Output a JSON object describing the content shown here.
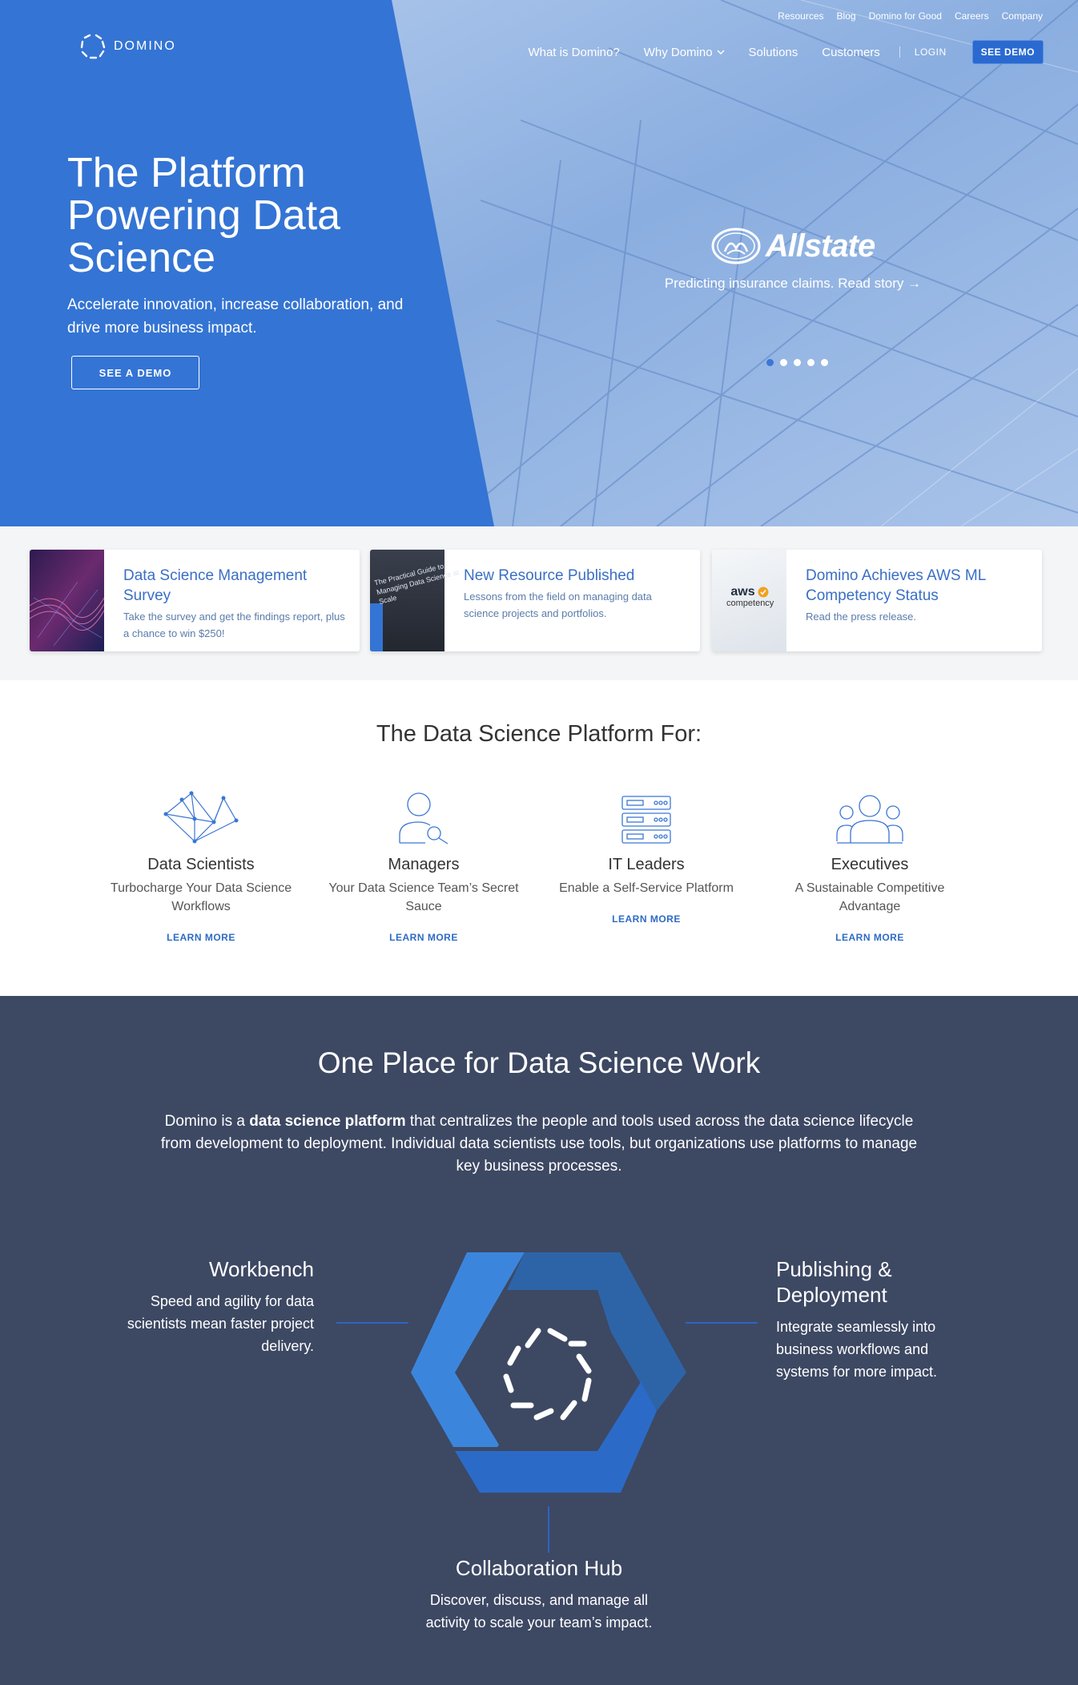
{
  "colors": {
    "hero_blue": "#3474d4",
    "accent_blue": "#2a6ad0",
    "link_blue": "#3a6fc4",
    "dark_section": "#3d4863"
  },
  "utility_nav": [
    "Resources",
    "Blog",
    "Domino for Good",
    "Careers",
    "Company"
  ],
  "logo": {
    "text": "DOMINO",
    "icon": "domino-logo-icon"
  },
  "main_nav": {
    "items": [
      "What is Domino?",
      "Why Domino",
      "Solutions",
      "Customers"
    ],
    "login": "LOGIN",
    "demo_button": "SEE DEMO"
  },
  "hero": {
    "title": "The Platform Powering Data Science",
    "subtitle": "Accelerate innovation, increase collaboration, and drive more business impact.",
    "cta": "SEE A DEMO",
    "slide": {
      "brand": "Allstate",
      "caption": "Predicting insurance claims. Read story →"
    },
    "carousel": {
      "count": 5,
      "active": 0
    }
  },
  "cards": [
    {
      "title": "Data Science Management Survey",
      "desc": "Take the survey and get the findings report, plus a chance to win $250!"
    },
    {
      "title": "New Resource Published",
      "desc": "Lessons from the field on managing data science projects and portfolios.",
      "thumb_text": "The Practical Guide to Managing Data Science at Scale"
    },
    {
      "title": "Domino Achieves AWS ML Competency Status",
      "desc": "Read the press release.",
      "thumb_text_1": "aws",
      "thumb_text_2": "competency"
    }
  ],
  "platform": {
    "heading": "The Data Science Platform For:",
    "personas": [
      {
        "title": "Data Scientists",
        "sub": "Turbocharge Your Data Science Workflows",
        "link": "LEARN MORE",
        "icon": "network-graph-icon"
      },
      {
        "title": "Managers",
        "sub": "Your Data Science Team’s Secret Sauce",
        "link": "LEARN MORE",
        "icon": "person-search-icon"
      },
      {
        "title": "IT Leaders",
        "sub": "Enable a Self-Service Platform",
        "link": "LEARN MORE",
        "icon": "server-rack-icon"
      },
      {
        "title": "Executives",
        "sub": "A Sustainable Competitive Advantage",
        "link": "LEARN MORE",
        "icon": "group-icon"
      }
    ]
  },
  "one_place": {
    "heading": "One Place for Data Science Work",
    "intro_before": "Domino is a ",
    "intro_bold": "data science platform",
    "intro_after": " that centralizes the people and tools used across the data science lifecycle from development to deployment. Individual data scientists use tools, but organizations use platforms to manage key business processes.",
    "workbench": {
      "title": "Workbench",
      "desc": "Speed and agility for data scientists mean faster project delivery."
    },
    "publishing": {
      "title": "Publishing & Deployment",
      "desc": "Integrate seamlessly into business workflows and systems for more impact."
    },
    "collab": {
      "title": "Collaboration Hub",
      "desc": "Discover, discuss, and manage all activity to scale your team’s impact."
    }
  }
}
